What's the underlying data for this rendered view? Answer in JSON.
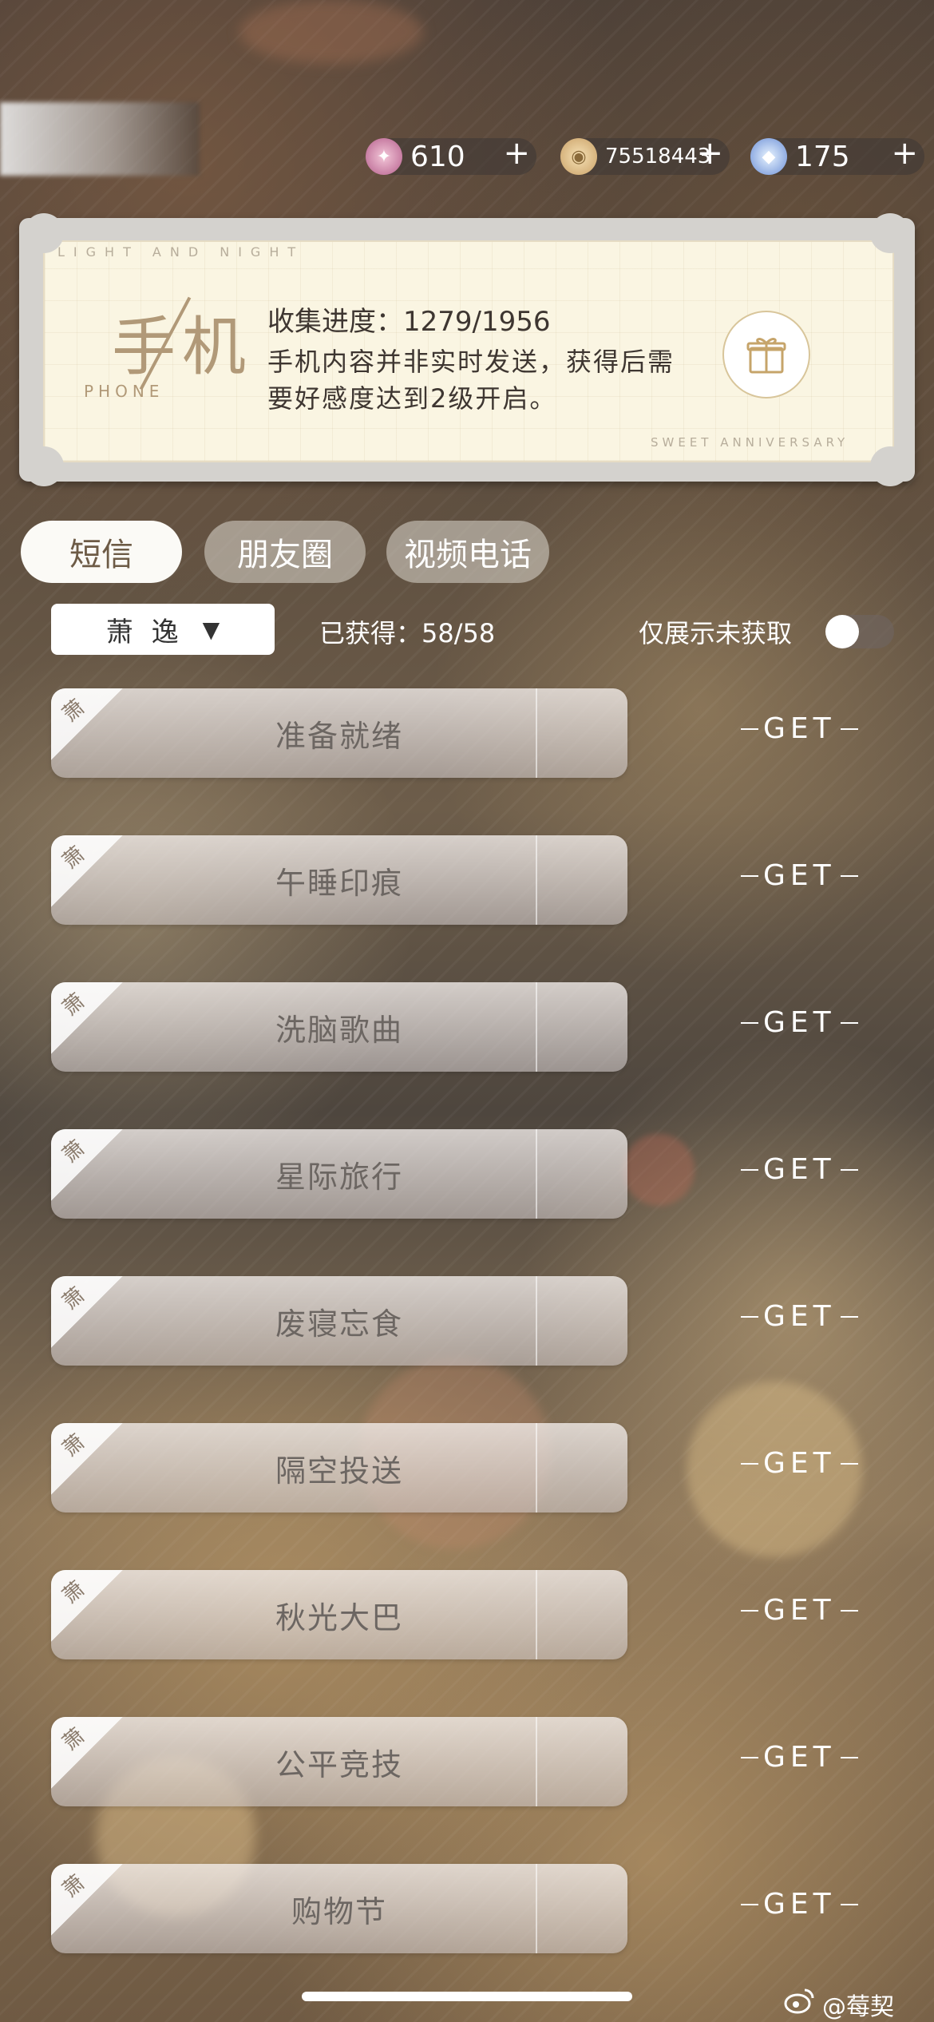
{
  "currencies": [
    {
      "icon": "pink-gem-icon",
      "value": "610",
      "plus": "+"
    },
    {
      "icon": "gold-coin-icon",
      "value": "75518443",
      "plus": "+"
    },
    {
      "icon": "blue-diamond-icon",
      "value": "175",
      "plus": "+"
    }
  ],
  "banner": {
    "brand_top": "LIGHT AND NIGHT",
    "brand_bottom": "SWEET ANNIVERSARY",
    "logo_zh": "手机",
    "logo_en": "PHONE",
    "progress": "收集进度：1279/1956",
    "description": "手机内容并非实时发送，获得后需要好感度达到2级开启。",
    "gift_icon": "gift-icon"
  },
  "tabs": [
    {
      "label": "短信",
      "active": true
    },
    {
      "label": "朋友圈",
      "active": false
    },
    {
      "label": "视频电话",
      "active": false
    }
  ],
  "filter": {
    "character": "萧 逸",
    "dropdown_arrow": "▼",
    "obtained": "已获得：58/58",
    "toggle_label": "仅展示未获取",
    "toggle_on": false
  },
  "messages": [
    {
      "mark": "萧",
      "title": "准备就绪",
      "status": "GET"
    },
    {
      "mark": "萧",
      "title": "午睡印痕",
      "status": "GET"
    },
    {
      "mark": "萧",
      "title": "洗脑歌曲",
      "status": "GET"
    },
    {
      "mark": "萧",
      "title": "星际旅行",
      "status": "GET"
    },
    {
      "mark": "萧",
      "title": "废寝忘食",
      "status": "GET"
    },
    {
      "mark": "萧",
      "title": "隔空投送",
      "status": "GET"
    },
    {
      "mark": "萧",
      "title": "秋光大巴",
      "status": "GET"
    },
    {
      "mark": "萧",
      "title": "公平竞技",
      "status": "GET"
    },
    {
      "mark": "萧",
      "title": "购物节",
      "status": "GET"
    }
  ],
  "watermark": "@莓契",
  "colors": {
    "accent_gold": "#b19978",
    "card_text": "#6c6662",
    "tab_active_text": "#6d5b46"
  }
}
